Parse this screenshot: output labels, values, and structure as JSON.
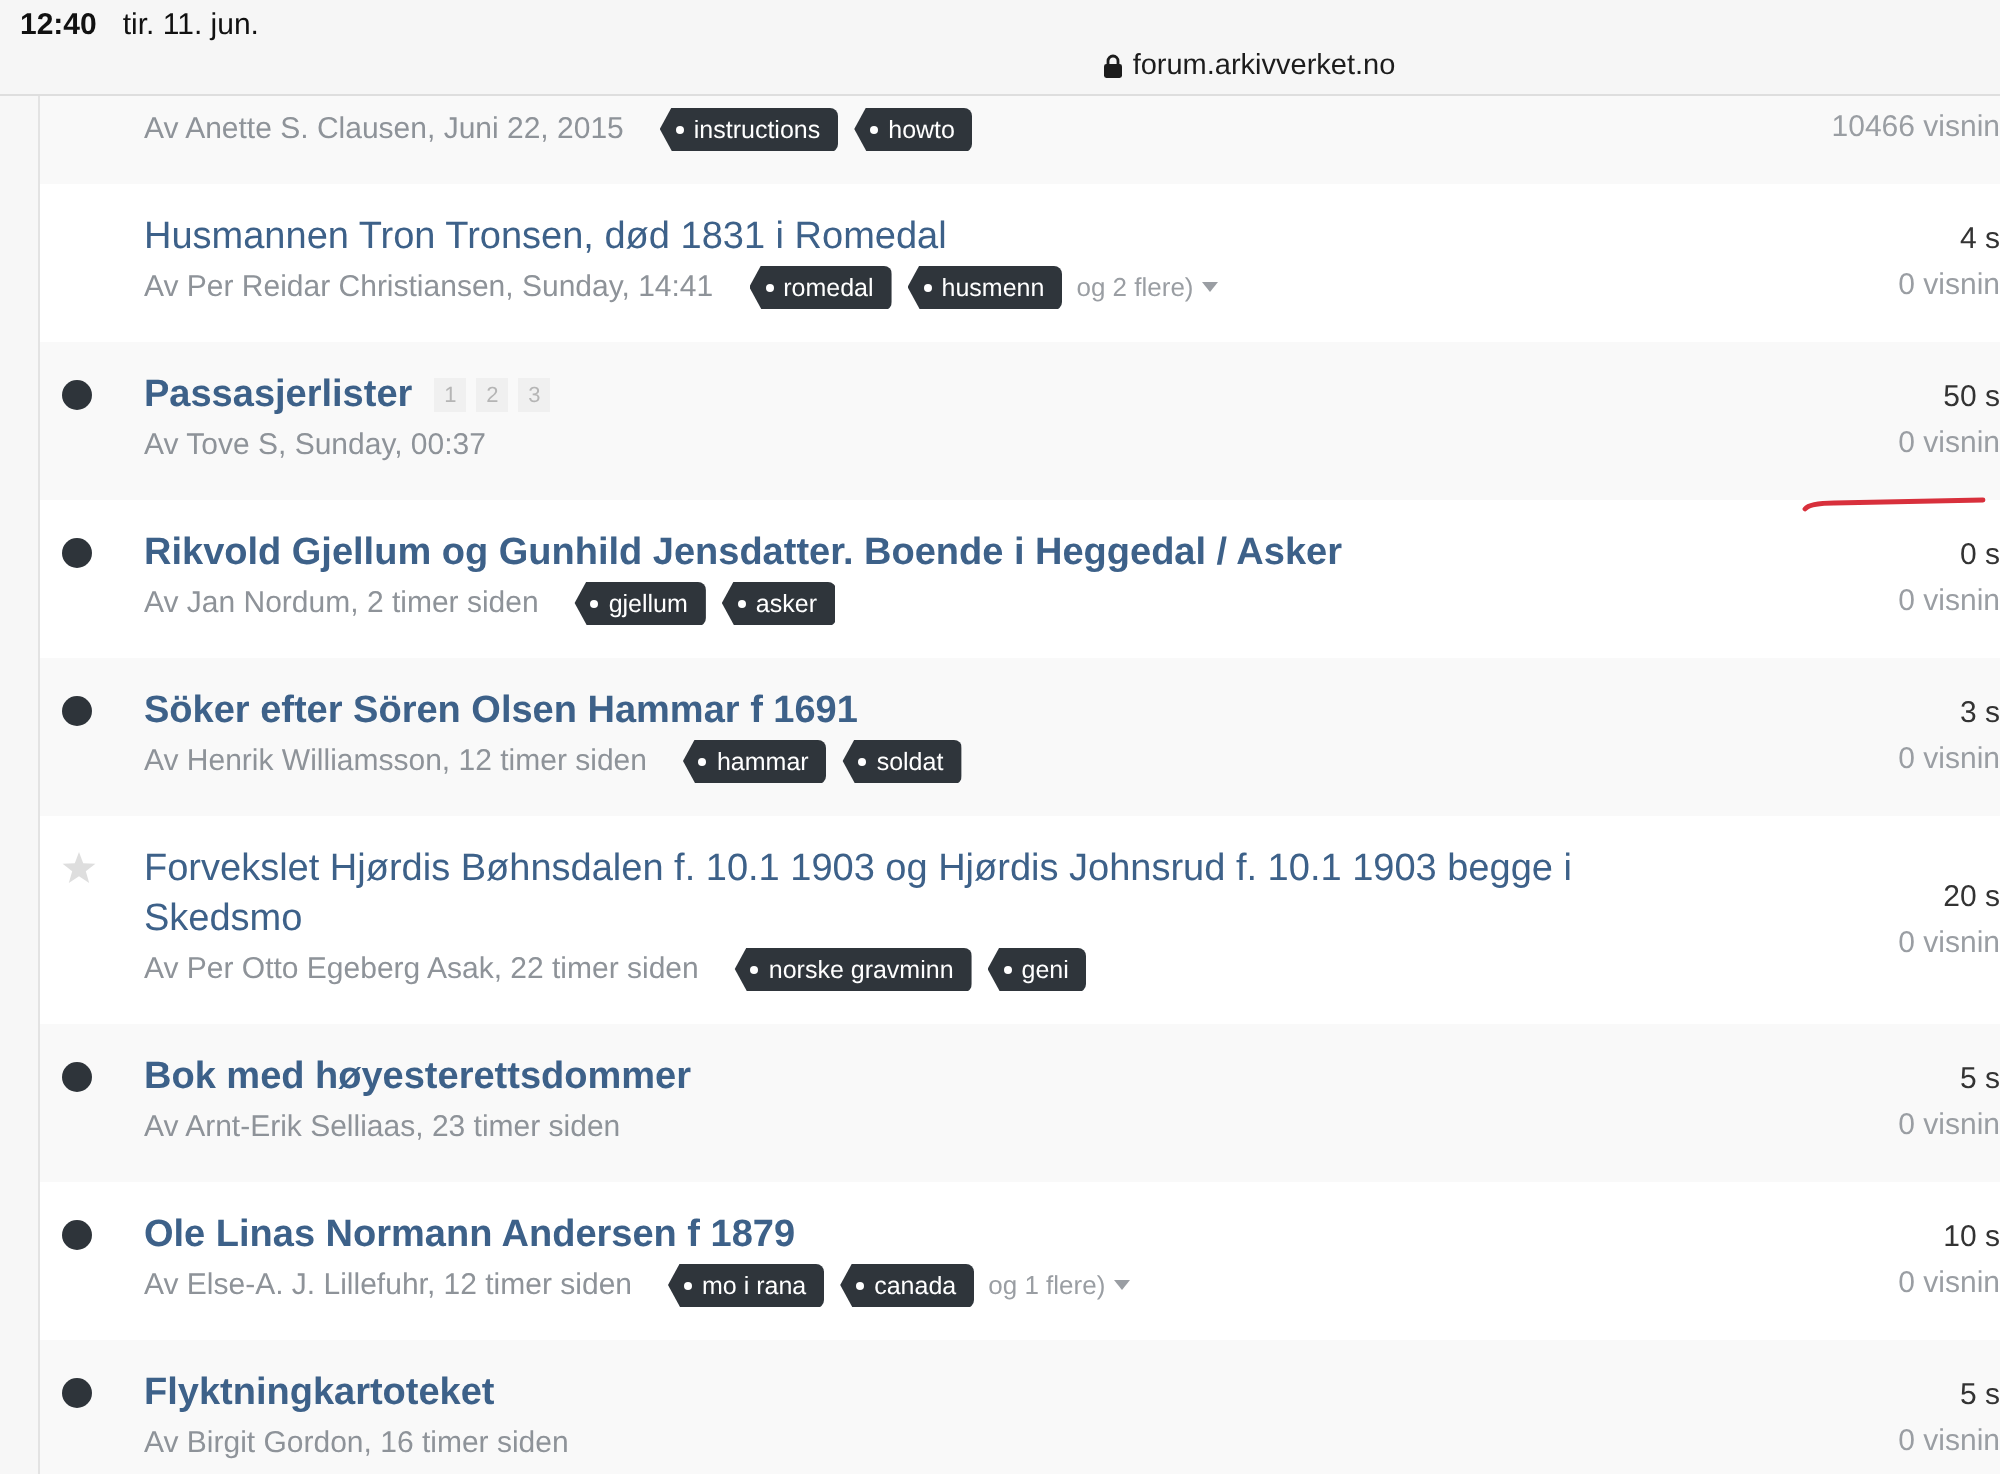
{
  "status_bar": {
    "time": "12:40",
    "date": "tir. 11. jun."
  },
  "address_bar": {
    "url": "forum.arkivverket.no"
  },
  "topics": [
    {
      "author_line": "Av Anette S. Clausen, Juni 22, 2015",
      "tags": [
        "instructions",
        "howto"
      ],
      "views": "10466 visnin"
    },
    {
      "unread": false,
      "starred": false,
      "title": "Husmannen Tron Tronsen, død 1831 i Romedal",
      "author_line": "Av Per Reidar Christiansen, Sunday, 14:41",
      "tags": [
        "romedal",
        "husmenn"
      ],
      "more_tags": "og 2 flere)",
      "replies": "4 s",
      "views": "0 visnin"
    },
    {
      "unread": true,
      "starred": false,
      "title": "Passasjerlister",
      "pages": [
        "1",
        "2",
        "3"
      ],
      "author_line": "Av Tove S, Sunday, 00:37",
      "replies": "50 s",
      "views": "0 visnin"
    },
    {
      "unread": true,
      "starred": false,
      "title": "Rikvold Gjellum og Gunhild Jensdatter. Boende i Heggedal / Asker",
      "author_line": "Av Jan Nordum, 2 timer siden",
      "tags": [
        "gjellum",
        "asker"
      ],
      "replies": "0 s",
      "views": "0 visnin"
    },
    {
      "unread": true,
      "starred": false,
      "title": "Söker efter Sören Olsen Hammar f 1691",
      "author_line": "Av Henrik Williamsson, 12 timer siden",
      "tags": [
        "hammar",
        "soldat"
      ],
      "replies": "3 s",
      "views": "0 visnin"
    },
    {
      "unread": false,
      "starred": true,
      "title": "Forvekslet Hjørdis Bøhnsdalen f. 10.1 1903 og Hjørdis Johnsrud f. 10.1 1903 begge i Skedsmo",
      "author_line": "Av Per Otto Egeberg Asak, 22 timer siden",
      "tags": [
        "norske gravminn",
        "geni"
      ],
      "replies": "20 s",
      "views": "0 visnin"
    },
    {
      "unread": true,
      "starred": false,
      "title": "Bok med høyesterettsdommer",
      "author_line": "Av Arnt-Erik Selliaas, 23 timer siden",
      "replies": "5 s",
      "views": "0 visnin"
    },
    {
      "unread": true,
      "starred": false,
      "title": "Ole Linas Normann Andersen f 1879",
      "author_line": "Av Else-A. J. Lillefuhr, 12 timer siden",
      "tags": [
        "mo i rana",
        "canada"
      ],
      "more_tags": "og 1 flere)",
      "replies": "10 s",
      "views": "0 visnin"
    },
    {
      "unread": true,
      "starred": false,
      "title": "Flyktningkartoteket",
      "author_line": "Av Birgit Gordon, 16 timer siden",
      "replies": "5 s",
      "views": "0 visnin"
    }
  ]
}
